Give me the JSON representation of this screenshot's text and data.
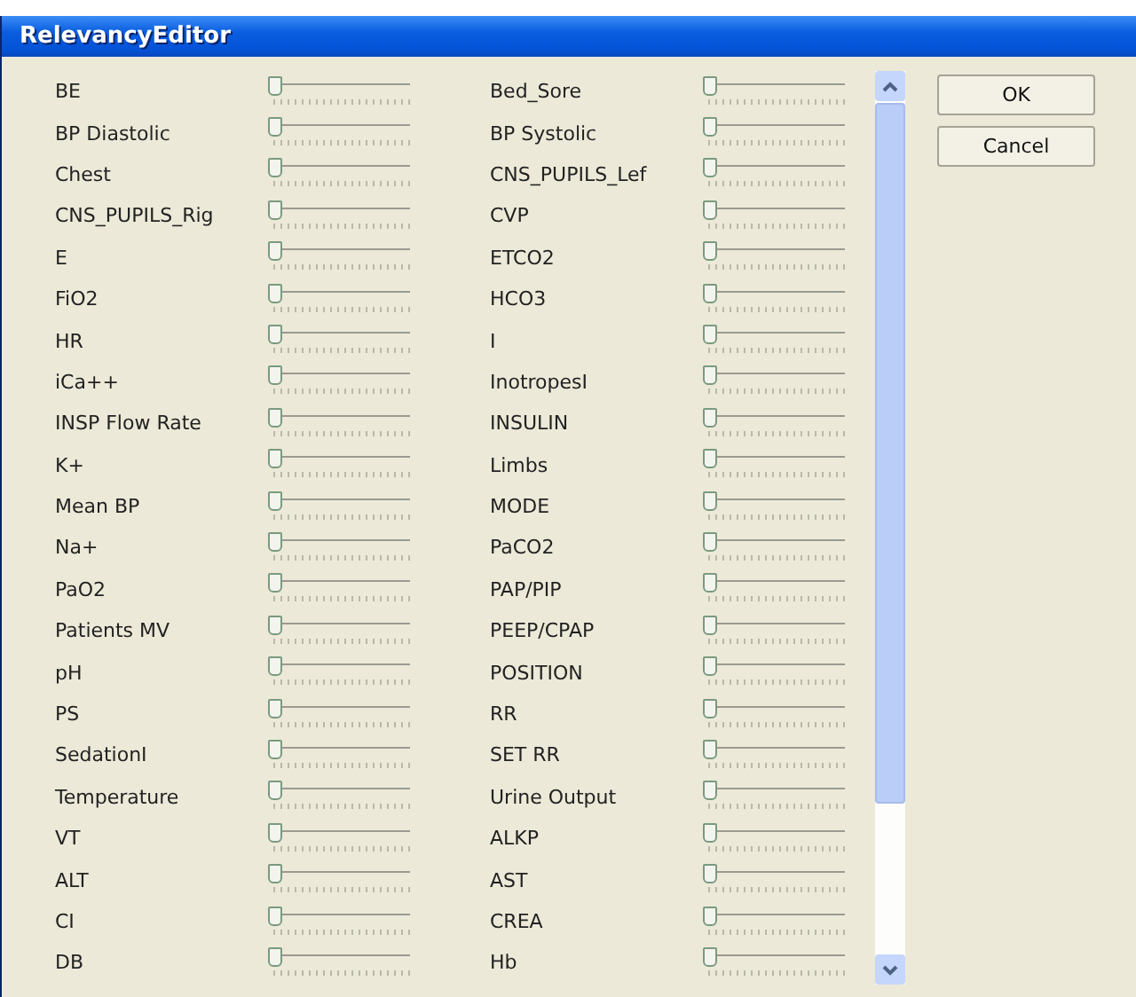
{
  "window": {
    "title": "RelevancyEditor"
  },
  "parameters": [
    {
      "name": "BE",
      "level": 0
    },
    {
      "name": "Bed_Sore",
      "level": 0
    },
    {
      "name": "BP Diastolic",
      "level": 0
    },
    {
      "name": "BP Systolic",
      "level": 0
    },
    {
      "name": "Chest",
      "level": 0
    },
    {
      "name": "CNS_PUPILS_Lef",
      "level": 0
    },
    {
      "name": "CNS_PUPILS_Rig",
      "level": 0
    },
    {
      "name": "CVP",
      "level": 0
    },
    {
      "name": "E",
      "level": 0
    },
    {
      "name": "ETCO2",
      "level": 0
    },
    {
      "name": "FiO2",
      "level": 0
    },
    {
      "name": "HCO3",
      "level": 0
    },
    {
      "name": "HR",
      "level": 0
    },
    {
      "name": "I",
      "level": 0
    },
    {
      "name": "iCa++",
      "level": 0
    },
    {
      "name": "InotropesI",
      "level": 0
    },
    {
      "name": "INSP Flow Rate",
      "level": 0
    },
    {
      "name": "INSULIN",
      "level": 0
    },
    {
      "name": "K+",
      "level": 0
    },
    {
      "name": "Limbs",
      "level": 0
    },
    {
      "name": "Mean BP",
      "level": 0
    },
    {
      "name": "MODE",
      "level": 0
    },
    {
      "name": "Na+",
      "level": 0
    },
    {
      "name": "PaCO2",
      "level": 0
    },
    {
      "name": "PaO2",
      "level": 0
    },
    {
      "name": "PAP/PIP",
      "level": 0
    },
    {
      "name": "Patients MV",
      "level": 0
    },
    {
      "name": "PEEP/CPAP",
      "level": 0
    },
    {
      "name": "pH",
      "level": 0
    },
    {
      "name": "POSITION",
      "level": 0
    },
    {
      "name": "PS",
      "level": 0
    },
    {
      "name": "RR",
      "level": 0
    },
    {
      "name": "SedationI",
      "level": 0
    },
    {
      "name": "SET RR",
      "level": 0
    },
    {
      "name": "Temperature",
      "level": 0
    },
    {
      "name": "Urine Output",
      "level": 0
    },
    {
      "name": "VT",
      "level": 0
    },
    {
      "name": "ALKP",
      "level": 0
    },
    {
      "name": "ALT",
      "level": 0
    },
    {
      "name": "AST",
      "level": 0
    },
    {
      "name": "CI",
      "level": 0
    },
    {
      "name": "CREA",
      "level": 0
    },
    {
      "name": "DB",
      "level": 0
    },
    {
      "name": "Hb",
      "level": 0
    }
  ],
  "buttons": [
    "OK",
    "Cancel"
  ]
}
